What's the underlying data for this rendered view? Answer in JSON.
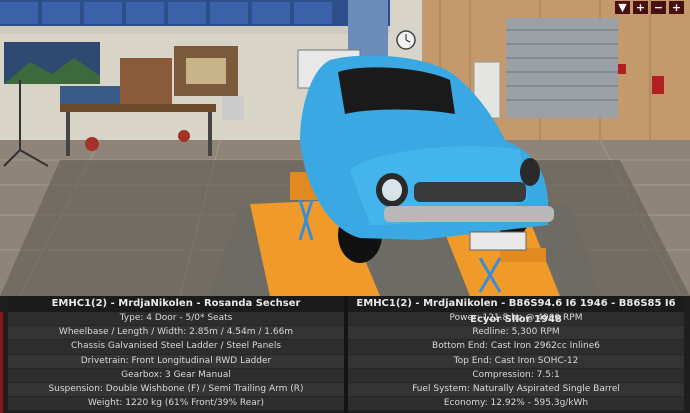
{
  "window_controls": {
    "menu_label": "▼",
    "zoom_in_label": "+",
    "minus_label": "−",
    "add_label": "+"
  },
  "colors": {
    "car_body": "#3aa8e2",
    "panel_bg": "#1f1f1f",
    "row_bg": "#343434",
    "text": "#d8d8d8",
    "accent_red": "#8a1a1a"
  },
  "left_panel": {
    "title": "EMHC1(2) - MrdjaNikolen - Rosanda Sechser",
    "rows": [
      "Type: 4 Door - 5/0* Seats",
      "Wheelbase / Length / Width: 2.85m / 4.54m / 1.66m",
      "Chassis Galvanised Steel Ladder / Steel Panels",
      "Drivetrain: Front Longitudinal RWD Ladder",
      "Gearbox: 3 Gear Manual",
      "Suspension: Double Wishbone (F) / Semi Trailing Arm (R)",
      "Weight: 1220 kg (61% Front/39% Rear)"
    ]
  },
  "right_panel": {
    "title": "EMHC1(2) - MrdjaNikolen - B86S94.6 I6 1946 - B86S85 I6 Ecyor Sllor 1948",
    "rows": [
      "Power: 121.8 hp @ 4900 RPM",
      "Redline:  5,300 RPM",
      "Bottom End: Cast Iron 2962cc Inline6",
      "Top End: Cast Iron SOHC-12",
      "Compression: 7.5:1",
      "Fuel System: Naturally Aspirated Single Barrel",
      "Economy: 12.92% - 595.3g/kWh"
    ]
  }
}
